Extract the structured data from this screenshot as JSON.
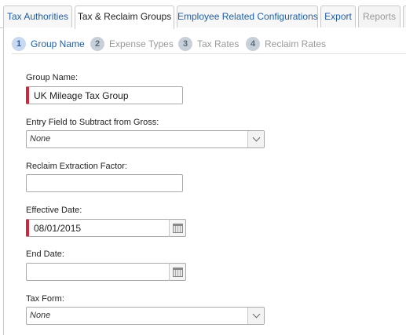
{
  "tabs": [
    {
      "label": "Tax Authorities",
      "state": "normal"
    },
    {
      "label": "Tax & Reclaim Groups",
      "state": "active"
    },
    {
      "label": "Employee Related Configurations",
      "state": "normal"
    },
    {
      "label": "Export",
      "state": "normal"
    },
    {
      "label": "Reports",
      "state": "disabled"
    }
  ],
  "steps": [
    {
      "num": "1",
      "label": "Group Name",
      "active": true
    },
    {
      "num": "2",
      "label": "Expense Types",
      "active": false
    },
    {
      "num": "3",
      "label": "Tax Rates",
      "active": false
    },
    {
      "num": "4",
      "label": "Reclaim Rates",
      "active": false
    }
  ],
  "form": {
    "group_name": {
      "label": "Group Name:",
      "value": "UK Mileage Tax Group",
      "required": true
    },
    "entry_field": {
      "label": "Entry Field to Subtract from Gross:",
      "value": "None"
    },
    "reclaim_factor": {
      "label": "Reclaim Extraction Factor:",
      "value": ""
    },
    "effective_date": {
      "label": "Effective Date:",
      "value": "08/01/2015",
      "required": true
    },
    "end_date": {
      "label": "End Date:",
      "value": ""
    },
    "tax_form": {
      "label": "Tax Form:",
      "value": "None"
    }
  },
  "colors": {
    "link": "#1f5fa6",
    "required": "#d0263a",
    "border": "#c9c9c9"
  }
}
